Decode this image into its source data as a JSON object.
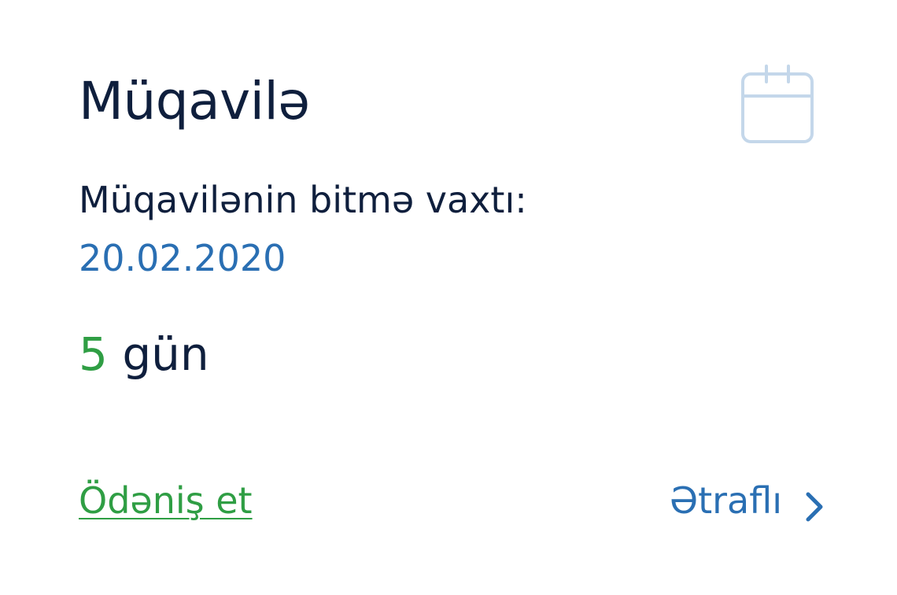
{
  "card": {
    "title": "Müqavilə",
    "end_label": "Müqavilənin bitmə vaxtı:",
    "end_date": "20.02.2020",
    "days_count": "5",
    "days_unit": "gün",
    "pay_link": "Ödəniş et",
    "more_link": "Ətraflı"
  },
  "icons": {
    "calendar": "calendar-icon",
    "chevron": "chevron-right-icon"
  },
  "colors": {
    "title": "#0f1f3d",
    "accent_blue": "#2a6fb3",
    "accent_green": "#2f9e44",
    "icon_light": "#c4d7ea"
  }
}
